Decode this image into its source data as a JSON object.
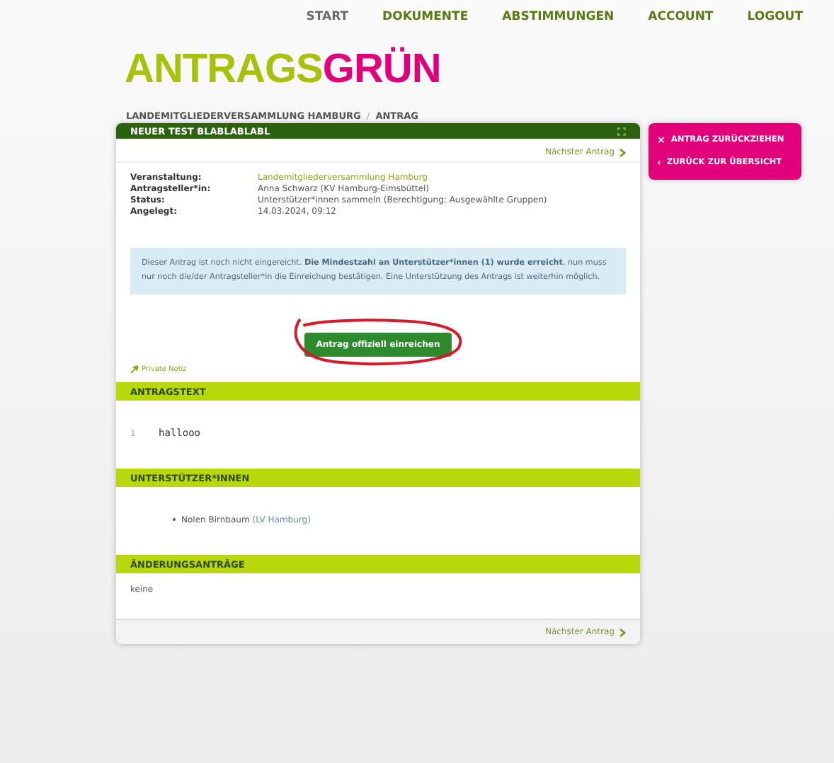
{
  "nav": [
    {
      "label": "START",
      "selected": true
    },
    {
      "label": "DOKUMENTE",
      "selected": false
    },
    {
      "label": "ABSTIMMUNGEN",
      "selected": false
    },
    {
      "label": "ACCOUNT",
      "selected": false
    },
    {
      "label": "LOGOUT",
      "selected": false
    }
  ],
  "logo": {
    "part_1": "ANTRAGS",
    "part_2": "GRÜN"
  },
  "breadcrumb": {
    "separator": "/",
    "items": [
      "LANDEMITGLIEDERVERSAMMLUNG HAMBURG",
      "ANTRAG"
    ]
  },
  "card": {
    "title": "NEUER TEST BLABLABLABL",
    "next_link": "Nächster Antrag",
    "details": [
      {
        "label": "Veranstaltung:",
        "value": "Landemitgliederversammlung Hamburg",
        "kind": "link"
      },
      {
        "label": "Antragsteller*in:",
        "value": "Anna Schwarz (KV Hamburg-Eimsbüttel)",
        "kind": "text"
      },
      {
        "label": "Status:",
        "value": "Unterstützer*innen sammeln (Berechtigung: Ausgewählte Gruppen)",
        "kind": "text"
      },
      {
        "label": "Angelegt:",
        "value": "14.03.2024, 09:12",
        "kind": "text"
      }
    ],
    "alert": "Dieser Antrag ist noch nicht eingereicht. **Die Mindestzahl an Unterstützer*innen (1) wurde erreicht**, nun muss nur noch die/der Antragsteller*in die Einreichung bestätigen. Eine Unterstützung des Antrags ist weiterhin möglich.",
    "submit_button": "Antrag offiziell einreichen",
    "private_note": "Private Notiz",
    "sections": [
      {
        "title": "ANTRAGSTEXT",
        "kind": "text",
        "lines": [
          {
            "number": "1",
            "text": "hallooo"
          }
        ]
      },
      {
        "title": "UNTERSTÜTZER*INNEN",
        "kind": "list",
        "items": [
          {
            "name": "Nolen Birnbaum",
            "group": "(LV Hamburg)"
          }
        ]
      },
      {
        "title": "ÄNDERUNGSANTRÄGE",
        "kind": "plain",
        "text": "keine"
      }
    ],
    "footer_link": "Nächster Antrag"
  },
  "sidebar": [
    {
      "icon": "×",
      "label": "ANTRAG ZURÜCKZIEHEN"
    },
    {
      "icon": "‹",
      "label": "ZURÜCK ZUR ÜBERSICHT"
    }
  ]
}
